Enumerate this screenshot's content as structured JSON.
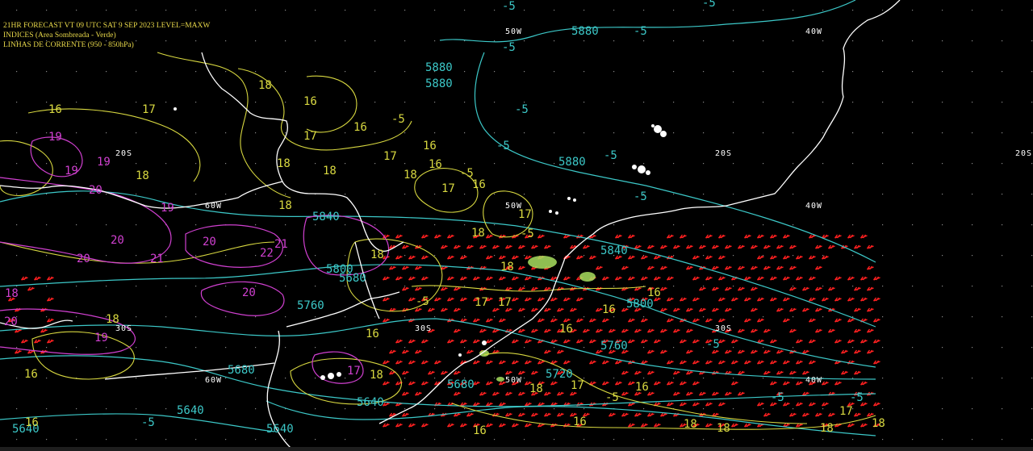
{
  "header": {
    "line1": "21HR FORECAST   VT 09 UTC SAT  9 SEP 2023   LEVEL=MAXW",
    "line2": "INDICES (Area Sombreada - Verde)",
    "line3": "LINHAS DE CORRENTE (950 - 850hPa)"
  },
  "colors": {
    "coast": "#ffffff",
    "yellow_contour": "#d8d840",
    "cyan_contour": "#3cc8c8",
    "magenta_contour": "#d040d0",
    "green_shade": "#a8e060",
    "wind_barb": "#ff2020",
    "header_text": "#e8d84a"
  },
  "grid_labels": [
    {
      "text": "50W",
      "kind": "lon"
    },
    {
      "text": "40W",
      "kind": "lon"
    },
    {
      "text": "20S",
      "kind": "lat"
    },
    {
      "text": "20S",
      "kind": "lat"
    },
    {
      "text": "20S",
      "kind": "lat"
    },
    {
      "text": "60W",
      "kind": "lon"
    },
    {
      "text": "50W",
      "kind": "lon"
    },
    {
      "text": "40W",
      "kind": "lon"
    },
    {
      "text": "30S",
      "kind": "lat"
    },
    {
      "text": "30S",
      "kind": "lat"
    },
    {
      "text": "30S",
      "kind": "lat"
    },
    {
      "text": "60W",
      "kind": "lon"
    },
    {
      "text": "50W",
      "kind": "lon"
    },
    {
      "text": "40W",
      "kind": "lon"
    }
  ],
  "cyan_labels": [
    "-5",
    "5880",
    "-5",
    "-5",
    "5880",
    "5880",
    "-5",
    "-5",
    "-5",
    "5880",
    "-5",
    "-5",
    "5840",
    "5840",
    "5800",
    "5800",
    "5760",
    "5760",
    "5720",
    "5680",
    "5680",
    "5640",
    "5640",
    "5640",
    "-5",
    "-5",
    "-5",
    "-5",
    "5680",
    "5640"
  ],
  "yellow_labels": [
    "16",
    "17",
    "18",
    "16",
    "-5",
    "16",
    "17",
    "16",
    "18",
    "18",
    "17",
    "18",
    "16",
    "-5",
    "18",
    "17",
    "16",
    "17",
    "18",
    "18",
    "-5",
    "18",
    "18",
    "16",
    "17",
    "16",
    "18",
    "16",
    "16",
    "16",
    "-5",
    "18",
    "16",
    "18",
    "-5",
    "16",
    "18",
    "18",
    "18",
    "17",
    "17",
    "18",
    "16",
    "16",
    "17"
  ],
  "magenta_labels": [
    "19",
    "19",
    "19",
    "20",
    "20",
    "20",
    "21",
    "22",
    "21",
    "20",
    "20",
    "19",
    "20",
    "19",
    "18",
    "17"
  ]
}
